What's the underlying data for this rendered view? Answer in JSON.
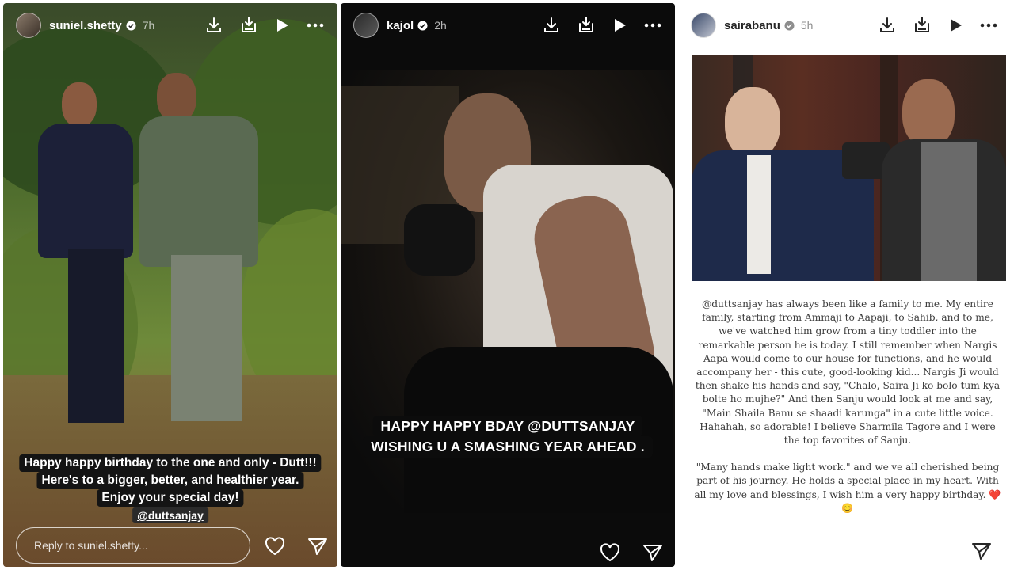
{
  "stories": [
    {
      "username": "suniel.shetty",
      "age": "7h",
      "caption_lines": [
        "Happy happy birthday to the one and only - Dutt!!!",
        "Here's to a bigger, better, and healthier year.",
        "Enjoy your special day!"
      ],
      "mention": "@duttsanjay",
      "reply_placeholder": "Reply to suniel.shetty..."
    },
    {
      "username": "kajol",
      "age": "2h",
      "caption_lines": [
        "HAPPY HAPPY BDAY @DUTTSANJAY",
        "WISHING U A SMASHING YEAR AHEAD ."
      ]
    },
    {
      "username": "sairabanu",
      "age": "5h",
      "paragraphs": [
        "@duttsanjay has always been like a family to me. My entire family, starting from Ammaji to Aapaji, to Sahib, and to me, we've watched him grow from a tiny toddler into the remarkable person he is today. I still remember when Nargis Aapa would come to our house for functions, and he would accompany her - this cute, good-looking kid... Nargis Ji would then shake his hands and say, \"Chalo, Saira Ji ko bolo tum kya bolte ho mujhe?\" And then Sanju would look at me and say, \"Main Shaila Banu se shaadi karunga\" in a cute little voice. Hahahah, so adorable! I believe Sharmila Tagore and I were the top favorites of Sanju.",
        "\"Many hands make light work.\" and we've all cherished being part of his journey. He holds a special place in my heart. With all my love and blessings, I wish him a very happy birthday. ❤️😊"
      ]
    }
  ],
  "icons": {
    "verified": "verified-badge-icon",
    "download": "download-icon",
    "save": "save-download-icon",
    "play": "play-icon",
    "more": "more-options-icon",
    "like": "heart-icon",
    "share": "send-icon"
  },
  "colors": {
    "verified_blue": "#0095f6",
    "caption_bg": "#141414",
    "heart_red": "#e0245e"
  }
}
